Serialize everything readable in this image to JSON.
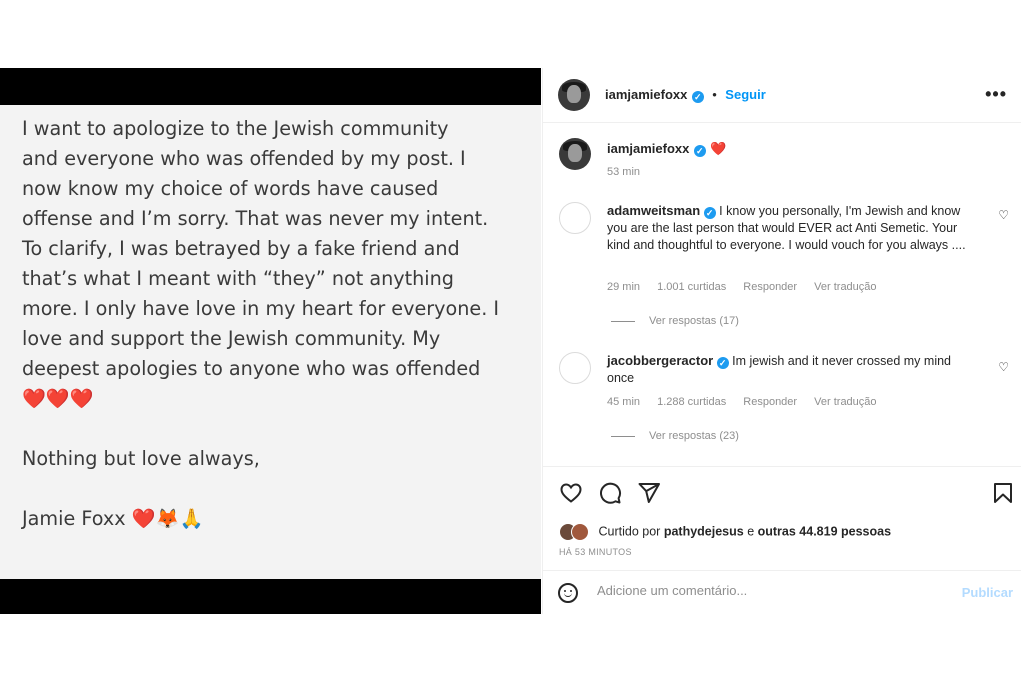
{
  "post_image": {
    "lines": [
      "I want to apologize to the Jewish community",
      "and everyone who was offended by my post.  I",
      "now know my choice of words have caused",
      "offense and I’m sorry. That was never my intent.",
      " To clarify, I was betrayed by a fake friend and",
      "that’s what I meant with “they” not anything",
      "more.  I only have love in my heart for everyone.  I",
      "love and support the Jewish community. My",
      "deepest apologies to anyone who was offended"
    ],
    "hearts": "❤️❤️❤️",
    "closing": "Nothing but love always,",
    "signature": "Jamie Foxx",
    "signature_emojis": "❤️🦊🙏"
  },
  "header": {
    "username": "iamjamiefoxx",
    "verified_mark": "✓",
    "separator": "•",
    "follow_label": "Seguir",
    "more_icon": "•••"
  },
  "caption": {
    "username": "iamjamiefoxx",
    "verified_mark": "✓",
    "text": "❤️",
    "time": "53 min"
  },
  "comments": [
    {
      "username": "adamweitsman",
      "verified_mark": "✓",
      "text": "I know you personally, I'm Jewish and know you are the last person that would EVER act Anti Semetic. Your kind and thoughtful to everyone. I would vouch for you always ....",
      "time": "29 min",
      "likes": "1.001 curtidas",
      "reply_label": "Responder",
      "translate_label": "Ver tradução",
      "replies_label": "Ver respostas (17)",
      "like_icon": "♡"
    },
    {
      "username": "jacobbergeractor",
      "verified_mark": "✓",
      "text": "Im jewish and it never crossed my mind once",
      "time": "45 min",
      "likes": "1.288 curtidas",
      "reply_label": "Responder",
      "translate_label": "Ver tradução",
      "replies_label": "Ver respostas (23)",
      "like_icon": "♡"
    }
  ],
  "actions": {
    "like_icon": "heart-outline",
    "comment_icon": "speech-bubble",
    "share_icon": "paper-plane",
    "save_icon": "bookmark",
    "liked_by_prefix": "Curtido por",
    "liked_by_user": "pathydejesus",
    "liked_by_connector": "e",
    "liked_by_others": "outras 44.819 pessoas",
    "posted_ago": "HÁ 53 MINUTOS"
  },
  "comment_box": {
    "placeholder": "Adicione um comentário...",
    "publish_label": "Publicar"
  },
  "colors": {
    "link_blue": "#0095f6",
    "verified_blue": "#1d9bf0",
    "heart_red": "#e0201f",
    "publish_disabled": "#b3dbff"
  }
}
